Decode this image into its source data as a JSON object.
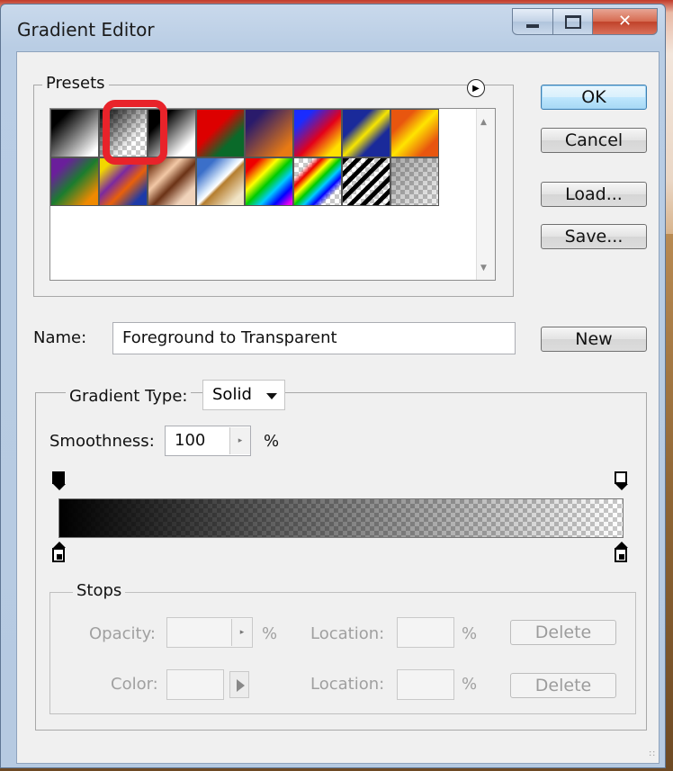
{
  "window": {
    "title": "Gradient Editor",
    "controls": {
      "minimize": "",
      "maximize": "",
      "close": "✕"
    }
  },
  "presets": {
    "label": "Presets",
    "menu_icon": "circle-right-arrow-icon",
    "swatches_row1": [
      "foreground-to-background",
      "foreground-to-transparent",
      "black-white",
      "red-green",
      "violet-orange",
      "blue-red-yellow",
      "blue-yellow-blue",
      "orange-yellow-orange"
    ],
    "swatches_row2": [
      "violet-green-orange",
      "yellow-violet-orange-blue",
      "copper",
      "chrome",
      "spectrum",
      "transparent-rainbow",
      "transparent-stripes",
      "neutral-density"
    ]
  },
  "buttons": {
    "ok": "OK",
    "cancel": "Cancel",
    "load": "Load...",
    "save": "Save...",
    "new": "New"
  },
  "name": {
    "label": "Name:",
    "value": "Foreground to Transparent"
  },
  "gradient": {
    "type_label": "Gradient Type:",
    "type_value": "Solid",
    "smoothness_label": "Smoothness:",
    "smoothness_value": "100",
    "smoothness_unit": "%"
  },
  "stops": {
    "label": "Stops",
    "opacity_label": "Opacity:",
    "opacity_unit": "%",
    "location_label": "Location:",
    "location_unit": "%",
    "color_label": "Color:",
    "delete": "Delete"
  },
  "colors": {
    "accent_highlight": "#e8232a",
    "default_button": "#3c7fb1"
  }
}
